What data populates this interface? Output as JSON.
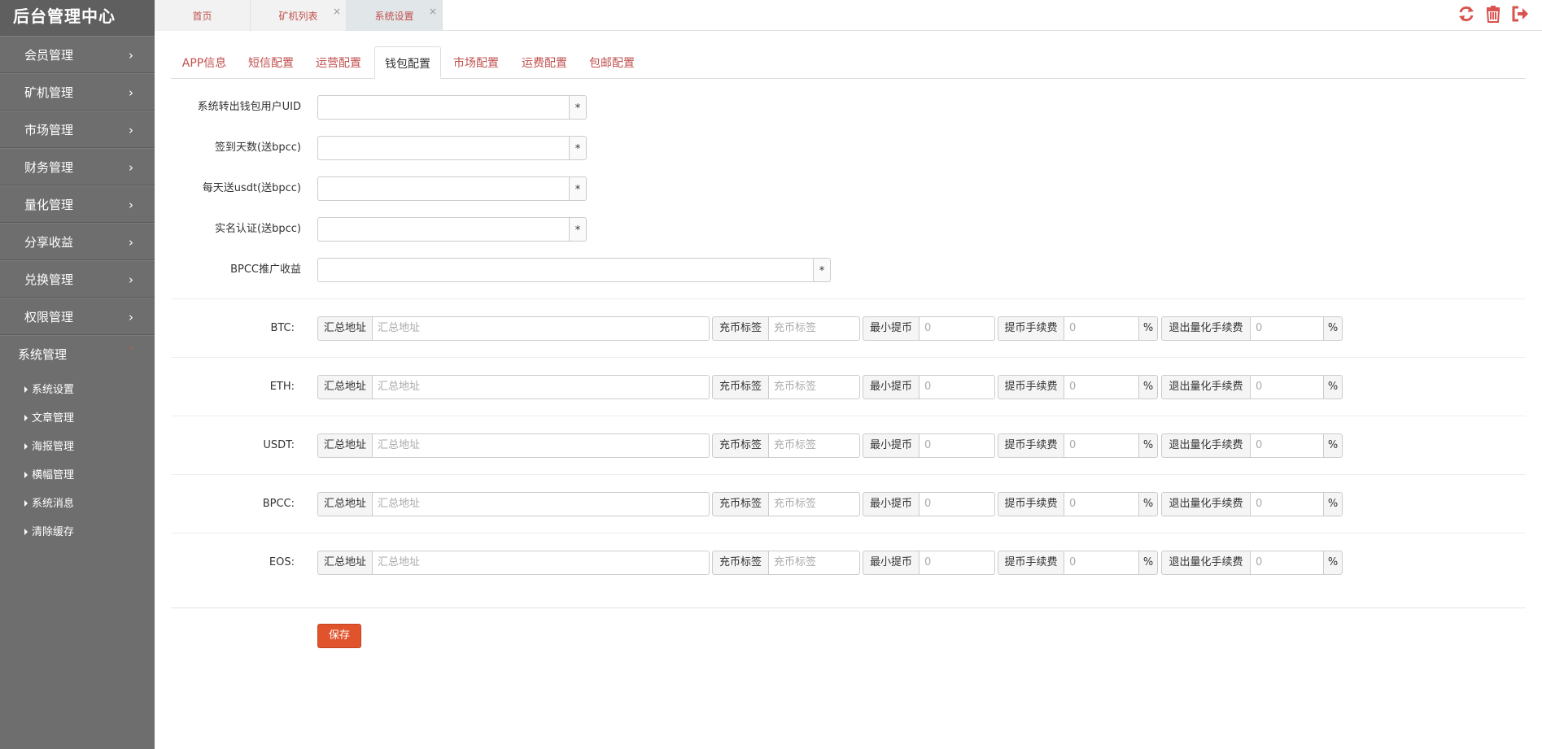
{
  "sidebar": {
    "brand": "后台管理中心",
    "menu": [
      {
        "label": "会员管理"
      },
      {
        "label": "矿机管理"
      },
      {
        "label": "市场管理"
      },
      {
        "label": "财务管理"
      },
      {
        "label": "量化管理"
      },
      {
        "label": "分享收益"
      },
      {
        "label": "兑换管理"
      },
      {
        "label": "权限管理"
      }
    ],
    "open_menu": {
      "label": "系统管理"
    },
    "submenu": [
      {
        "label": "系统设置"
      },
      {
        "label": "文章管理"
      },
      {
        "label": "海报管理"
      },
      {
        "label": "横幅管理"
      },
      {
        "label": "系统消息"
      },
      {
        "label": "清除缓存"
      }
    ]
  },
  "topbar": {
    "tabs": [
      {
        "label": "首页"
      },
      {
        "label": "矿机列表"
      },
      {
        "label": "系统设置"
      }
    ],
    "close_glyph": "×",
    "icons": [
      "refresh-icon",
      "trash-icon",
      "logout-icon"
    ],
    "accent_color": "#d9534f"
  },
  "settings_tabs": [
    {
      "label": "APP信息"
    },
    {
      "label": "短信配置"
    },
    {
      "label": "运营配置"
    },
    {
      "label": "钱包配置"
    },
    {
      "label": "市场配置"
    },
    {
      "label": "运费配置"
    },
    {
      "label": "包邮配置"
    }
  ],
  "form": {
    "fields": [
      {
        "label": "系统转出钱包用户UID",
        "value": "",
        "suffix": "*"
      },
      {
        "label": "签到天数(送bpcc)",
        "value": "",
        "suffix": "*"
      },
      {
        "label": "每天送usdt(送bpcc)",
        "value": "",
        "suffix": "*"
      },
      {
        "label": "实名认证(送bpcc)",
        "value": "",
        "suffix": "*"
      },
      {
        "label": "BPCC推广收益",
        "value": "",
        "suffix": "*"
      }
    ],
    "coin_headers": {
      "address": "汇总地址",
      "tag": "充币标签",
      "min": "最小提币",
      "fee": "提币手续费",
      "quant_fee": "退出量化手续费",
      "percent": "%"
    },
    "coins": [
      {
        "label": "BTC:",
        "address_placeholder": "汇总地址",
        "tag_placeholder": "充币标签",
        "min": "0",
        "fee": "0",
        "quant_fee": "0"
      },
      {
        "label": "ETH:",
        "address_placeholder": "汇总地址",
        "tag_placeholder": "充币标签",
        "min": "0",
        "fee": "0",
        "quant_fee": "0"
      },
      {
        "label": "USDT:",
        "address_placeholder": "汇总地址",
        "tag_placeholder": "充币标签",
        "min": "0",
        "fee": "0",
        "quant_fee": "0"
      },
      {
        "label": "BPCC:",
        "address_placeholder": "汇总地址",
        "tag_placeholder": "充币标签",
        "min": "0",
        "fee": "0",
        "quant_fee": "0"
      },
      {
        "label": "EOS:",
        "address_placeholder": "汇总地址",
        "tag_placeholder": "充币标签",
        "min": "0",
        "fee": "0",
        "quant_fee": "0"
      }
    ],
    "save_label": "保存"
  }
}
